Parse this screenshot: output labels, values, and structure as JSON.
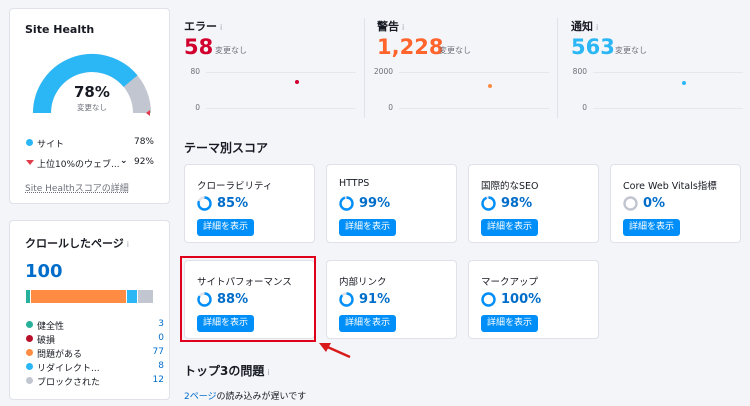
{
  "site_health": {
    "title": "Site Health",
    "score": "78%",
    "score_sub": "変更なし",
    "gauge_value": 0.78,
    "legend": [
      {
        "label": "サイト",
        "value": "78%",
        "color": "#2bb7f6"
      },
      {
        "label": "上位10%のウェブ...",
        "value": "92%",
        "color": "#e03b4a"
      }
    ],
    "details_link": "Site Healthスコアの詳細"
  },
  "crawled": {
    "title": "クロールしたページ",
    "info": "i",
    "total": "100",
    "bar_segments": [
      {
        "name": "healthy",
        "fraction": 0.03,
        "color": "#27b09a"
      },
      {
        "name": "broken",
        "fraction": 0.0,
        "color": "#b8102a"
      },
      {
        "name": "issues",
        "fraction": 0.77,
        "color": "#ff8c42"
      },
      {
        "name": "redirect",
        "fraction": 0.08,
        "color": "#2bb7f6"
      },
      {
        "name": "blocked",
        "fraction": 0.12,
        "color": "#c2c6d1"
      }
    ],
    "items": [
      {
        "label": "健全性",
        "value": "3",
        "color": "#27b09a"
      },
      {
        "label": "破損",
        "value": "0",
        "color": "#b8102a"
      },
      {
        "label": "問題がある",
        "value": "77",
        "color": "#ff8c42"
      },
      {
        "label": "リダイレクト...",
        "value": "8",
        "color": "#2bb7f6"
      },
      {
        "label": "ブロックされた",
        "value": "12",
        "color": "#c2c6d1"
      }
    ]
  },
  "metrics": [
    {
      "label": "エラー",
      "info": "i",
      "value": "58",
      "sub": "変更なし",
      "color": "#d1002f",
      "axis_top": "80",
      "axis_bottom": "0",
      "point": 58,
      "max": 80,
      "point_color": "#d1002f"
    },
    {
      "label": "警告",
      "info": "i",
      "value": "1,228",
      "sub": "変更なし",
      "color": "#ff642d",
      "axis_top": "2000",
      "axis_bottom": "0",
      "point": 1228,
      "max": 2000,
      "point_color": "#ff8c42"
    },
    {
      "label": "通知",
      "info": "i",
      "value": "563",
      "sub": "変更なし",
      "color": "#2bb7f6",
      "axis_top": "800",
      "axis_bottom": "0",
      "point": 563,
      "max": 800,
      "point_color": "#2bb7f6"
    }
  ],
  "thematic": {
    "title": "テーマ別スコア",
    "button_label": "詳細を表示",
    "cards": [
      {
        "name": "クローラビリティ",
        "pct": "85%",
        "value": 0.85
      },
      {
        "name": "HTTPS",
        "pct": "99%",
        "value": 0.99
      },
      {
        "name": "国際的なSEO",
        "pct": "98%",
        "value": 0.98
      },
      {
        "name": "Core Web Vitals指標",
        "pct": "0%",
        "value": 0.0
      },
      {
        "name": "サイトパフォーマンス",
        "pct": "88%",
        "value": 0.88
      },
      {
        "name": "内部リンク",
        "pct": "91%",
        "value": 0.91
      },
      {
        "name": "マークアップ",
        "pct": "100%",
        "value": 1.0
      }
    ]
  },
  "top_issues": {
    "title": "トップ3の問題",
    "info": "i",
    "first_link": "2ページ",
    "first_text": "の読み込みが遅いです"
  },
  "colors": {
    "accent": "#008ff8",
    "highlight": "#e0001b",
    "arrow": "#d91a1a"
  }
}
